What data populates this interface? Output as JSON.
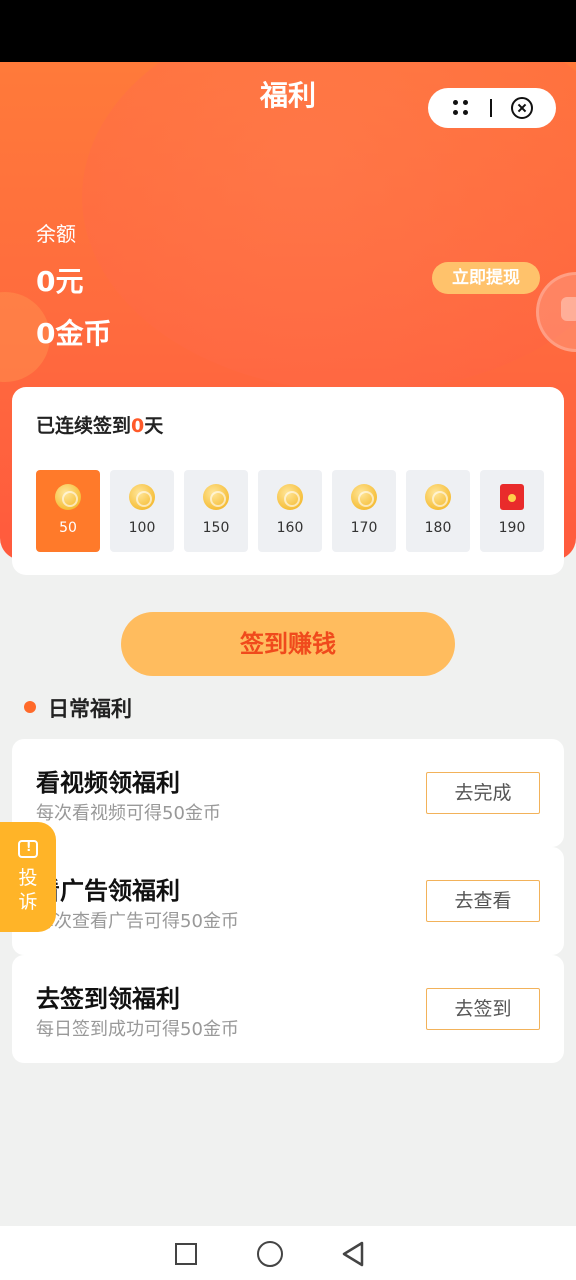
{
  "header": {
    "title": "福利"
  },
  "balance": {
    "label": "余额",
    "yuan": "0元",
    "coins": "0金币",
    "withdraw_label": "立即提现"
  },
  "signin": {
    "title_prefix": "已连续签到",
    "days_count": "0",
    "title_suffix": "天",
    "days": [
      {
        "value": "50",
        "icon": "coin-icon",
        "active": true
      },
      {
        "value": "100",
        "icon": "coin-icon",
        "active": false
      },
      {
        "value": "150",
        "icon": "coin-icon",
        "active": false
      },
      {
        "value": "160",
        "icon": "coin-icon",
        "active": false
      },
      {
        "value": "170",
        "icon": "coin-icon",
        "active": false
      },
      {
        "value": "180",
        "icon": "coin-icon",
        "active": false
      },
      {
        "value": "190",
        "icon": "red-envelope-icon",
        "active": false
      }
    ],
    "button_label": "签到赚钱"
  },
  "daily": {
    "section_title": "日常福利",
    "tasks": [
      {
        "title": "看视频领福利",
        "desc": "每次看视频可得50金币",
        "button": "去完成"
      },
      {
        "title": "看广告领福利",
        "desc": "每次查看广告可得50金币",
        "button": "去查看"
      },
      {
        "title": "去签到领福利",
        "desc": "每日签到成功可得50金币",
        "button": "去签到"
      }
    ]
  },
  "complain": {
    "label": "投诉"
  },
  "colors": {
    "accent": "#ff6a3e",
    "button": "#ffbc5e",
    "active_day": "#ff7a2a"
  }
}
